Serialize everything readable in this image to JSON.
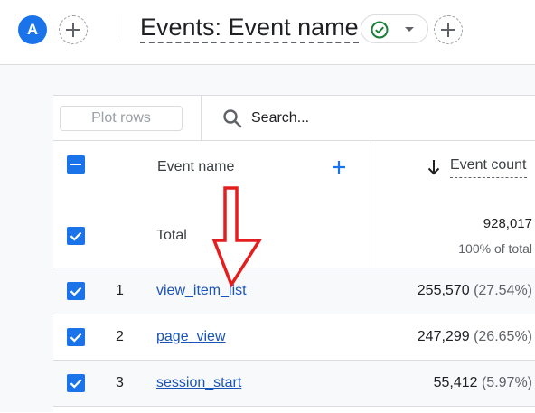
{
  "header": {
    "avatar_letter": "A",
    "title": "Events: Event name",
    "status_icon": "check-circle-icon",
    "accent_color": "#1a73e8",
    "success_color": "#188038"
  },
  "toolbar": {
    "plot_rows_label": "Plot rows",
    "search_placeholder": "Search..."
  },
  "table": {
    "dimension_header": "Event name",
    "metric_header": "Event count",
    "sort": "descending",
    "total": {
      "label": "Total",
      "value": "928,017",
      "share": "100% of total"
    },
    "rows": [
      {
        "index": "1",
        "name": "view_item_list",
        "value": "255,570",
        "pct": "(27.54%)"
      },
      {
        "index": "2",
        "name": "page_view",
        "value": "247,299",
        "pct": "(26.65%)"
      },
      {
        "index": "3",
        "name": "session_start",
        "value": "55,412",
        "pct": "(5.97%)"
      }
    ]
  },
  "annotation": {
    "arrow_color": "#e41e1e",
    "direction": "down"
  }
}
